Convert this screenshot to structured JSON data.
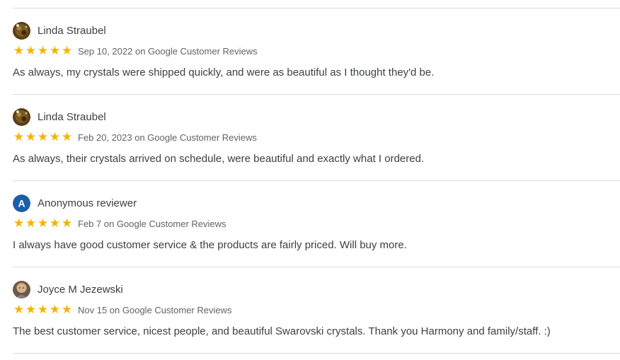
{
  "colors": {
    "star": "#f4b400",
    "divider": "#dadce0",
    "anon_avatar_bg": "#1a5ea8",
    "text": "#3c4043",
    "meta": "#5f6368"
  },
  "reviews": [
    {
      "name": "Linda Straubel",
      "avatar": "photo-avatar",
      "rating": 5,
      "date": "Sep 10, 2022 on Google Customer Reviews",
      "text": "As always, my crystals were shipped quickly, and were as beautiful as I thought they'd be."
    },
    {
      "name": "Linda Straubel",
      "avatar": "photo-avatar",
      "rating": 5,
      "date": "Feb 20, 2023 on Google Customer Reviews",
      "text": "As always, their crystals arrived on schedule, were beautiful and exactly what I ordered."
    },
    {
      "name": "Anonymous reviewer",
      "avatar": "letter-avatar",
      "avatar_letter": "A",
      "rating": 5,
      "date": "Feb 7 on Google Customer Reviews",
      "text": "I always have good customer service & the products are fairly priced. Will buy more."
    },
    {
      "name": "Joyce M Jezewski",
      "avatar": "photo-avatar",
      "rating": 5,
      "date": "Nov 15 on Google Customer Reviews",
      "text": "The best customer service, nicest people, and beautiful Swarovski crystals. Thank you Harmony and family/staff. :)"
    }
  ]
}
